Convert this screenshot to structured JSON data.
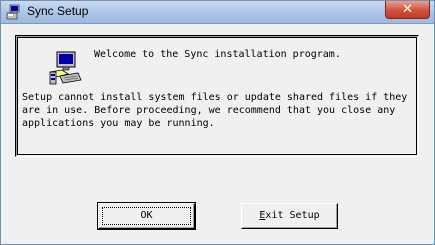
{
  "window": {
    "title": "Sync Setup",
    "close_glyph": "✕"
  },
  "dialog": {
    "welcome": "Welcome to the Sync installation program.",
    "description": "Setup cannot install system files or update shared files if they are in use.  Before proceeding, we recommend that you close any applications you may be running."
  },
  "buttons": {
    "ok_label": "OK",
    "exit_mnemonic": "E",
    "exit_rest": "xit Setup"
  },
  "icons": {
    "title": "setup-computer-icon",
    "dialog": "setup-computer-icon"
  }
}
